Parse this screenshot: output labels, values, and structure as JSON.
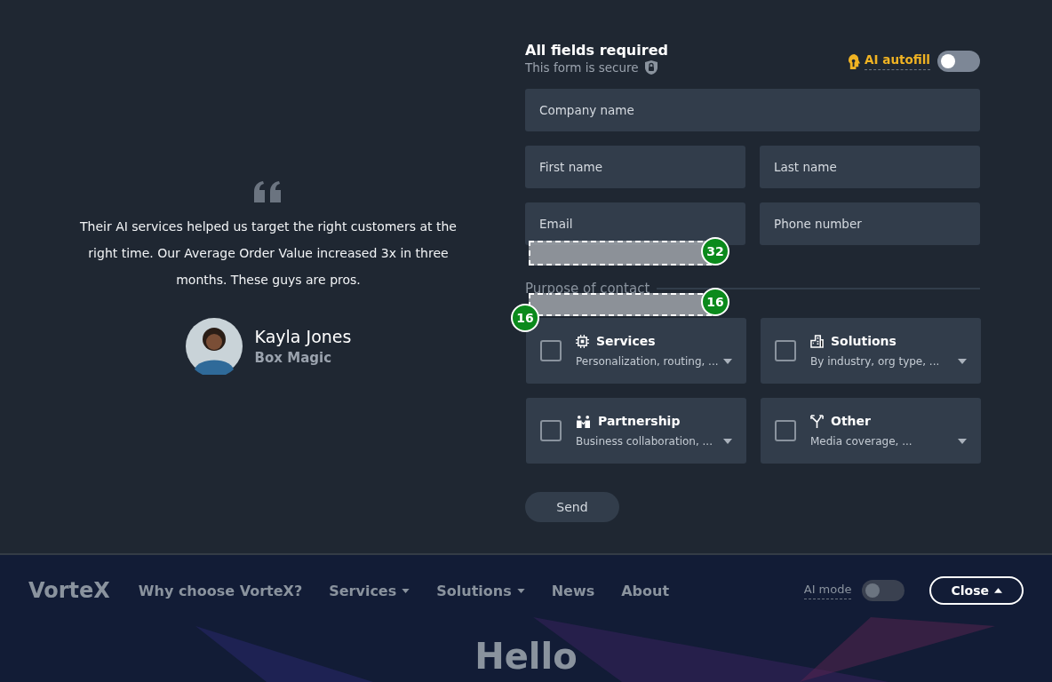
{
  "testimonial": {
    "quote": "Their AI services helped us target the right customers at the right time. Our Average Order Value increased 3x in three months. These guys are pros.",
    "author": "Kayla Jones",
    "company": "Box Magic"
  },
  "form": {
    "title": "All fields required",
    "secure_note": "This form is secure",
    "ai_autofill": {
      "label": "AI autofill",
      "on": false
    },
    "fields": [
      {
        "placeholder": "Company name",
        "kind": "full"
      },
      {
        "placeholder": "First name",
        "kind": "half"
      },
      {
        "placeholder": "Last name",
        "kind": "half"
      },
      {
        "placeholder": "Email",
        "kind": "half"
      },
      {
        "placeholder": "Phone number",
        "kind": "half"
      }
    ],
    "purpose_label": "Purpose of contact",
    "spacing_markers": [
      {
        "label": "32",
        "kind": "above"
      },
      {
        "label": "16",
        "kind": "below"
      },
      {
        "label": "16",
        "kind": "left"
      }
    ],
    "purposes": [
      {
        "title": "Services",
        "summary": "Personalization, routing, ...",
        "checked": false,
        "kind": "chip"
      },
      {
        "title": "Solutions",
        "summary": "By industry, org type, ...",
        "checked": false,
        "kind": "building"
      },
      {
        "title": "Partnership",
        "summary": "Business collaboration, ...",
        "checked": false,
        "kind": "people"
      },
      {
        "title": "Other",
        "summary": "Media coverage, ...",
        "checked": false,
        "kind": "split"
      }
    ],
    "send_button": "Send"
  },
  "navbar": {
    "logo": "VorteX",
    "links": [
      {
        "label": "Why choose VorteX?",
        "dropdown": false
      },
      {
        "label": "Services",
        "dropdown": true
      },
      {
        "label": "Solutions",
        "dropdown": true
      },
      {
        "label": "News",
        "dropdown": false
      },
      {
        "label": "About",
        "dropdown": false
      }
    ],
    "ai_mode": {
      "label": "AI mode",
      "on": false
    },
    "close_button": "Close"
  },
  "hero": {
    "heading": "Hello"
  }
}
